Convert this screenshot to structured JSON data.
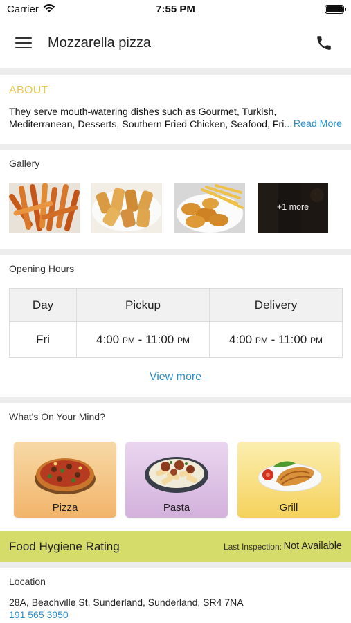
{
  "status_bar": {
    "carrier": "Carrier",
    "time": "7:55 PM"
  },
  "header": {
    "title": "Mozzarella pizza"
  },
  "about": {
    "heading": "ABOUT",
    "text": "They serve mouth-watering dishes such as Gourmet, Turkish, Mediterranean, Desserts, Southern Fried Chicken, Seafood, Fri...",
    "read_more": "Read More"
  },
  "gallery": {
    "label": "Gallery",
    "more_label": "+1 more"
  },
  "opening_hours": {
    "label": "Opening Hours",
    "headers": [
      "Day",
      "Pickup",
      "Delivery"
    ],
    "row": {
      "day": "Fri",
      "pickup_start": "4:00",
      "pickup_end": "11:00",
      "delivery_start": "4:00",
      "delivery_end": "11:00",
      "period": "PM"
    },
    "view_more": "View more"
  },
  "mind": {
    "label": "What's On Your Mind?",
    "categories": [
      {
        "label": "Pizza",
        "color_top": "#f7d9a6",
        "color_bottom": "#f2b46a"
      },
      {
        "label": "Pasta",
        "color_top": "#ead6ef",
        "color_bottom": "#d3b1dc"
      },
      {
        "label": "Grill",
        "color_top": "#fbeeb0",
        "color_bottom": "#f5d25c"
      }
    ]
  },
  "hygiene": {
    "title": "Food Hygiene Rating",
    "last_inspection_label": "Last Inspection:",
    "last_inspection_value": "Not Available"
  },
  "location": {
    "label": "Location",
    "address": "28A, Beachville St, Sunderland, Sunderland, SR4 7NA",
    "phone": "191 565 3950"
  },
  "colors": {
    "accent_blue": "#2a8ecb",
    "about_heading": "#e9c94a",
    "hygiene_bar": "#d6dc6a"
  }
}
